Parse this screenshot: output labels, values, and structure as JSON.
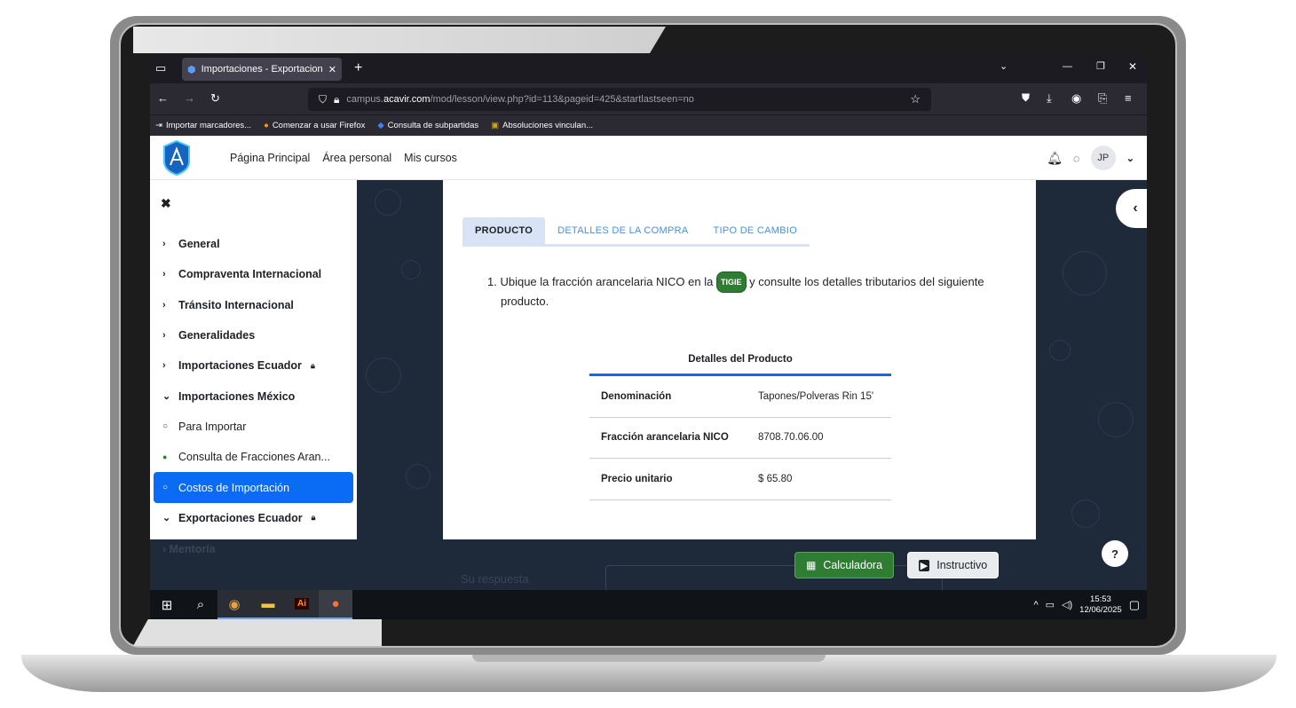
{
  "browser": {
    "tab_title": "Importaciones - Exportaciones:",
    "url_prefix": "campus.",
    "url_host": "acavir.com",
    "url_path": "/mod/lesson/view.php?id=113&pageid=425&startlastseen=no",
    "bookmarks": [
      {
        "label": "Importar marcadores...",
        "icon": "import-icon"
      },
      {
        "label": "Comenzar a usar Firefox",
        "icon": "firefox-icon"
      },
      {
        "label": "Consulta de subpartidas",
        "icon": "diamond-icon"
      },
      {
        "label": "Absoluciones vinculan...",
        "icon": "document-icon"
      }
    ]
  },
  "nav": {
    "links": [
      "Página Principal",
      "Área personal",
      "Mis cursos"
    ],
    "avatar_initials": "JP"
  },
  "drawer": {
    "close_label": "✖",
    "items": [
      {
        "label": "General",
        "type": "section",
        "marker": "›",
        "locked": false
      },
      {
        "label": "Compraventa Internacional",
        "type": "section",
        "marker": "›",
        "locked": false
      },
      {
        "label": "Tránsito Internacional",
        "type": "section",
        "marker": "›",
        "locked": false
      },
      {
        "label": "Generalidades",
        "type": "section",
        "marker": "›",
        "locked": false
      },
      {
        "label": "Importaciones Ecuador",
        "type": "section",
        "marker": "›",
        "locked": true
      },
      {
        "label": "Importaciones México",
        "type": "section",
        "marker": "⌄",
        "locked": false
      },
      {
        "label": "Para Importar",
        "type": "activity",
        "marker": "○",
        "locked": false
      },
      {
        "label": "Consulta de Fracciones Aran...",
        "type": "activity-done",
        "marker": "●",
        "locked": false
      },
      {
        "label": "Costos de Importación",
        "type": "activity-active",
        "marker": "○",
        "locked": false
      },
      {
        "label": "Exportaciones Ecuador",
        "type": "section",
        "marker": "⌄",
        "locked": true
      }
    ],
    "faded_item": "Mentoría"
  },
  "content": {
    "tabs": [
      {
        "label": "PRODUCTO",
        "active": true
      },
      {
        "label": "DETALLES DE LA COMPRA",
        "active": false
      },
      {
        "label": "TIPO DE CAMBIO",
        "active": false
      }
    ],
    "instruction_before": "1. Ubique la fracción arancelaria NICO en la",
    "instruction_badge": "TIGIE",
    "instruction_after": "y consulte los detalles tributarios del siguiente",
    "instruction_line2": "producto.",
    "table_title": "Detalles del Producto",
    "rows": [
      {
        "label": "Denominación",
        "value": "Tapones/Polveras Rin 15'"
      },
      {
        "label": "Fracción arancelaria NICO",
        "value": "8708.70.06.00"
      },
      {
        "label": "Precio unitario",
        "value": "$ 65.80"
      }
    ],
    "answer_label": "Su respuesta"
  },
  "buttons": {
    "calc_label": "Calculadora",
    "instructive_label": "Instructivo",
    "help_label": "?"
  },
  "taskbar": {
    "time": "15:53",
    "date": "12/06/2025"
  },
  "colors": {
    "accent": "#0a6cf5",
    "success": "#2e7d32",
    "dark_bg": "#1e2a3a",
    "browser_bg": "#1c1b22"
  }
}
